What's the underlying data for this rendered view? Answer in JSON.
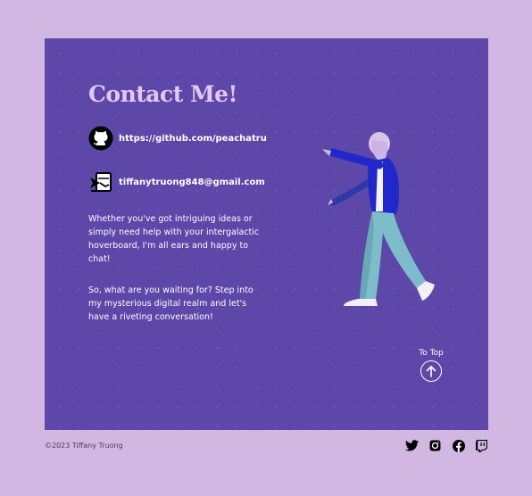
{
  "contact": {
    "title": "Contact Me!",
    "github_link": "https://github.com/peachatru",
    "email_link": "tiffanytruong848@gmail.com",
    "paragraph_1": "Whether you've got intriguing ideas or simply need help with your intergalactic hoverboard, I'm all ears and happy to chat!",
    "paragraph_2": "So, what are you waiting for? Step into my mysterious digital realm and let's have a riveting conversation!",
    "to_top_label": "To Top"
  },
  "footer": {
    "copyright": "©2023 Tiffany Truong",
    "socials": [
      "twitter-icon",
      "instagram-icon",
      "facebook-icon",
      "twitch-icon"
    ]
  },
  "colors": {
    "page_background": "#d3b7e3",
    "card_background": "#5d47a8",
    "title": "#e2c7ee",
    "text": "#ffffff"
  }
}
